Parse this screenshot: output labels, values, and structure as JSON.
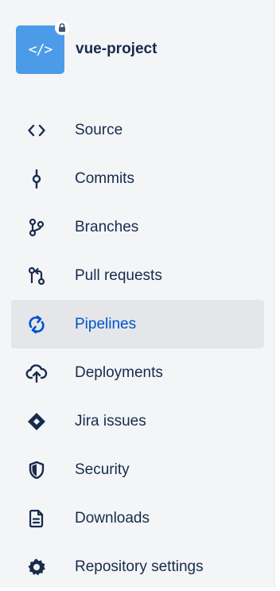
{
  "project": {
    "name": "vue-project",
    "avatar_icon": "code-brackets-icon",
    "badge_icon": "lock-icon",
    "avatar_color": "#4c9be8"
  },
  "nav": {
    "items": [
      {
        "label": "Source",
        "icon": "source-icon"
      },
      {
        "label": "Commits",
        "icon": "commit-icon"
      },
      {
        "label": "Branches",
        "icon": "branch-icon"
      },
      {
        "label": "Pull requests",
        "icon": "pull-request-icon"
      },
      {
        "label": "Pipelines",
        "icon": "pipelines-icon",
        "active": true
      },
      {
        "label": "Deployments",
        "icon": "cloud-upload-icon"
      },
      {
        "label": "Jira issues",
        "icon": "jira-icon"
      },
      {
        "label": "Security",
        "icon": "shield-icon"
      },
      {
        "label": "Downloads",
        "icon": "document-icon"
      },
      {
        "label": "Repository settings",
        "icon": "gear-icon"
      }
    ]
  },
  "colors": {
    "text": "#172b4d",
    "active_text": "#0052cc",
    "active_bg": "#e4e6ea",
    "sidebar_bg": "#f4f5f7"
  }
}
